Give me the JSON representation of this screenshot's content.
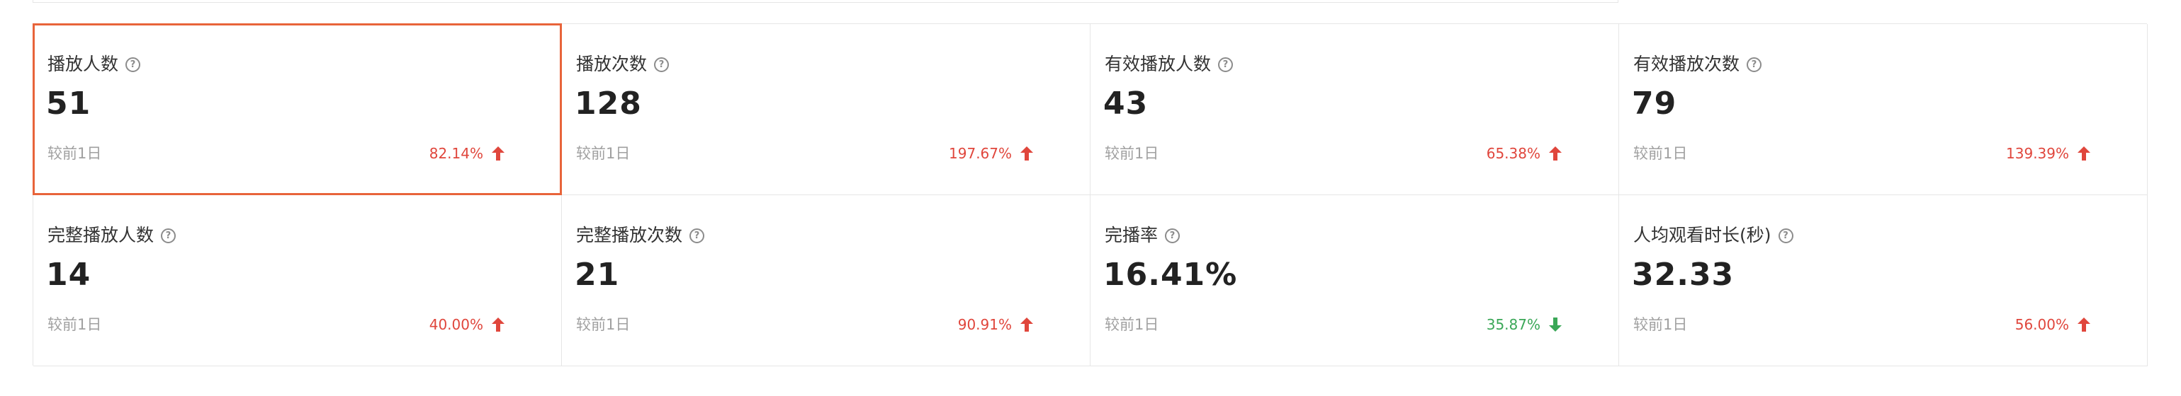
{
  "colors": {
    "up": "#e0463c",
    "down": "#3aa757",
    "selected_border": "#e8643a"
  },
  "cards": [
    {
      "title": "播放人数",
      "value": "51",
      "compare_label": "较前1日",
      "change": "82.14%",
      "direction": "up",
      "icon": "arrow-up-icon",
      "selected": true
    },
    {
      "title": "播放次数",
      "value": "128",
      "compare_label": "较前1日",
      "change": "197.67%",
      "direction": "up",
      "icon": "arrow-up-icon"
    },
    {
      "title": "有效播放人数",
      "value": "43",
      "compare_label": "较前1日",
      "change": "65.38%",
      "direction": "up",
      "icon": "arrow-up-icon"
    },
    {
      "title": "有效播放次数",
      "value": "79",
      "compare_label": "较前1日",
      "change": "139.39%",
      "direction": "up",
      "icon": "arrow-up-icon"
    },
    {
      "title": "完整播放人数",
      "value": "14",
      "compare_label": "较前1日",
      "change": "40.00%",
      "direction": "up",
      "icon": "arrow-up-icon"
    },
    {
      "title": "完整播放次数",
      "value": "21",
      "compare_label": "较前1日",
      "change": "90.91%",
      "direction": "up",
      "icon": "arrow-up-icon"
    },
    {
      "title": "完播率",
      "value": "16.41%",
      "compare_label": "较前1日",
      "change": "35.87%",
      "direction": "down",
      "icon": "arrow-down-icon"
    },
    {
      "title": "人均观看时长(秒)",
      "value": "32.33",
      "compare_label": "较前1日",
      "change": "56.00%",
      "direction": "up",
      "icon": "arrow-up-icon"
    }
  ],
  "help_icon": {
    "glyph": "?"
  }
}
